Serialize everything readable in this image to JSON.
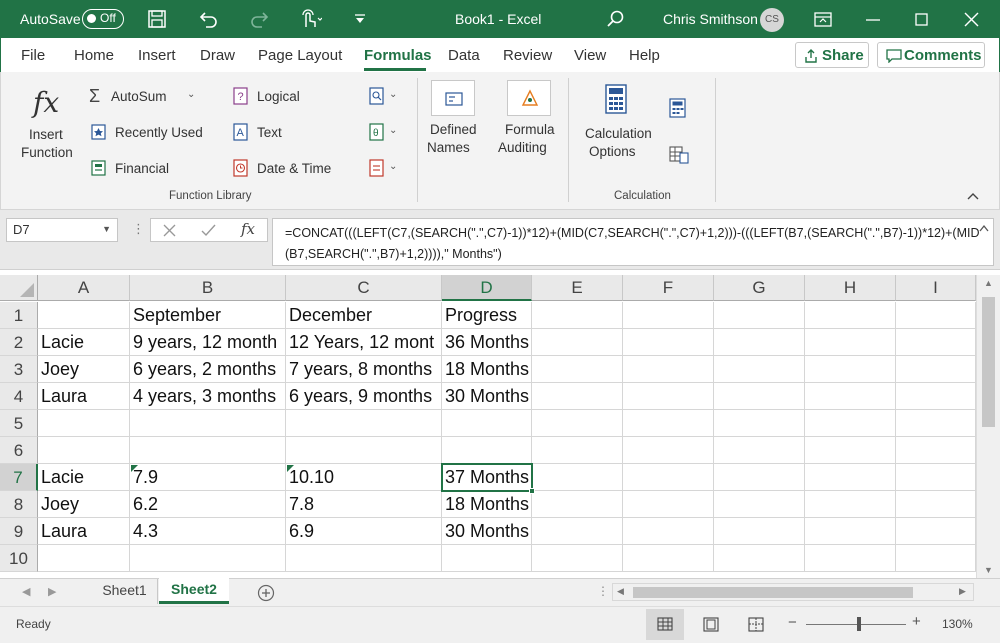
{
  "titlebar": {
    "autosave_label": "AutoSave",
    "autosave_state": "Off",
    "doc_title": "Book1  -  Excel",
    "user_name": "Chris Smithson",
    "user_initials": "CS"
  },
  "ribbon_tabs": [
    "File",
    "Home",
    "Insert",
    "Draw",
    "Page Layout",
    "Formulas",
    "Data",
    "Review",
    "View",
    "Help"
  ],
  "share_label": "Share",
  "comments_label": "Comments",
  "function_library": {
    "insert_function_line1": "Insert",
    "insert_function_line2": "Function",
    "autosum": "AutoSum",
    "recently_used": "Recently Used",
    "financial": "Financial",
    "logical": "Logical",
    "text": "Text",
    "date_time": "Date & Time",
    "group_label": "Function Library"
  },
  "defined_names": {
    "line1": "Defined",
    "line2": "Names"
  },
  "formula_auditing": {
    "line1": "Formula",
    "line2": "Auditing"
  },
  "calculation": {
    "line1": "Calculation",
    "line2": "Options",
    "group_label": "Calculation"
  },
  "name_box": "D7",
  "fx_label": "fx",
  "formula_text": "=CONCAT(((LEFT(C7,(SEARCH(\".\",C7)-1))*12)+(MID(C7,SEARCH(\".\",C7)+1,2)))-(((LEFT(B7,(SEARCH(\".\",B7)-1))*12)+(MID(B7,SEARCH(\".\",B7)+1,2)))),\" Months\")",
  "columns": [
    "A",
    "B",
    "C",
    "D",
    "E",
    "F",
    "G",
    "H",
    "I"
  ],
  "rows": [
    {
      "num": "1",
      "cells": [
        "",
        "September",
        "December",
        "Progress"
      ]
    },
    {
      "num": "2",
      "cells": [
        "Lacie",
        "9 years, 12 month",
        "12 Years, 12 mont",
        "36 Months"
      ]
    },
    {
      "num": "3",
      "cells": [
        "Joey",
        "6 years, 2 months",
        "7 years, 8 months",
        "18 Months"
      ]
    },
    {
      "num": "4",
      "cells": [
        "Laura",
        "4 years, 3 months",
        "6 years, 9 months",
        "30 Months"
      ]
    },
    {
      "num": "5",
      "cells": [
        "",
        "",
        "",
        ""
      ]
    },
    {
      "num": "6",
      "cells": [
        "",
        "",
        "",
        ""
      ]
    },
    {
      "num": "7",
      "cells": [
        "Lacie",
        "7.9",
        "10.10",
        "37 Months"
      ]
    },
    {
      "num": "8",
      "cells": [
        "Joey",
        "6.2",
        "7.8",
        "18 Months"
      ]
    },
    {
      "num": "9",
      "cells": [
        "Laura",
        "4.3",
        "6.9",
        "30 Months"
      ]
    },
    {
      "num": "10",
      "cells": [
        "",
        "",
        "",
        ""
      ]
    }
  ],
  "sheets": [
    "Sheet1",
    "Sheet2"
  ],
  "active_sheet": "Sheet2",
  "status": "Ready",
  "zoom": "130%",
  "zoom_minus": "−",
  "zoom_plus": "+",
  "accent_color": "#217346"
}
